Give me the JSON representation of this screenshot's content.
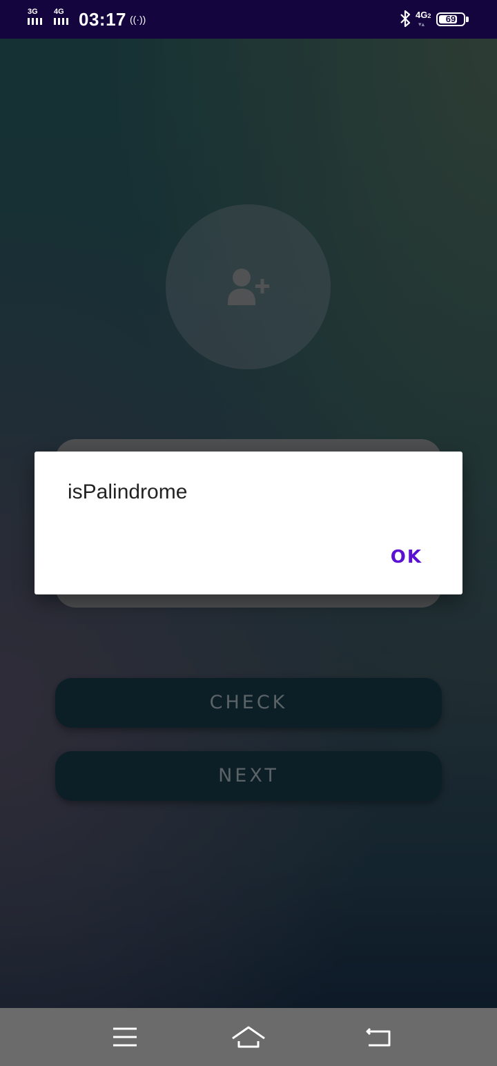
{
  "status_bar": {
    "sim1_network": "3G",
    "sim2_network": "4G",
    "time": "03:17",
    "hotspot_glyph": "((·))",
    "bluetooth_icon": "bluetooth-icon",
    "right_network": "4G",
    "right_network_sub": "2",
    "battery_level": "69"
  },
  "app": {
    "avatar_icon": "add-person-icon",
    "buttons": {
      "check": "CHECK",
      "next": "NEXT"
    }
  },
  "dialog": {
    "message": "isPalindrome",
    "ok_label": "OK",
    "accent_color": "#5b11d1"
  },
  "nav_bar": {
    "menu_icon": "menu-icon",
    "home_icon": "home-icon",
    "back_icon": "back-icon"
  }
}
